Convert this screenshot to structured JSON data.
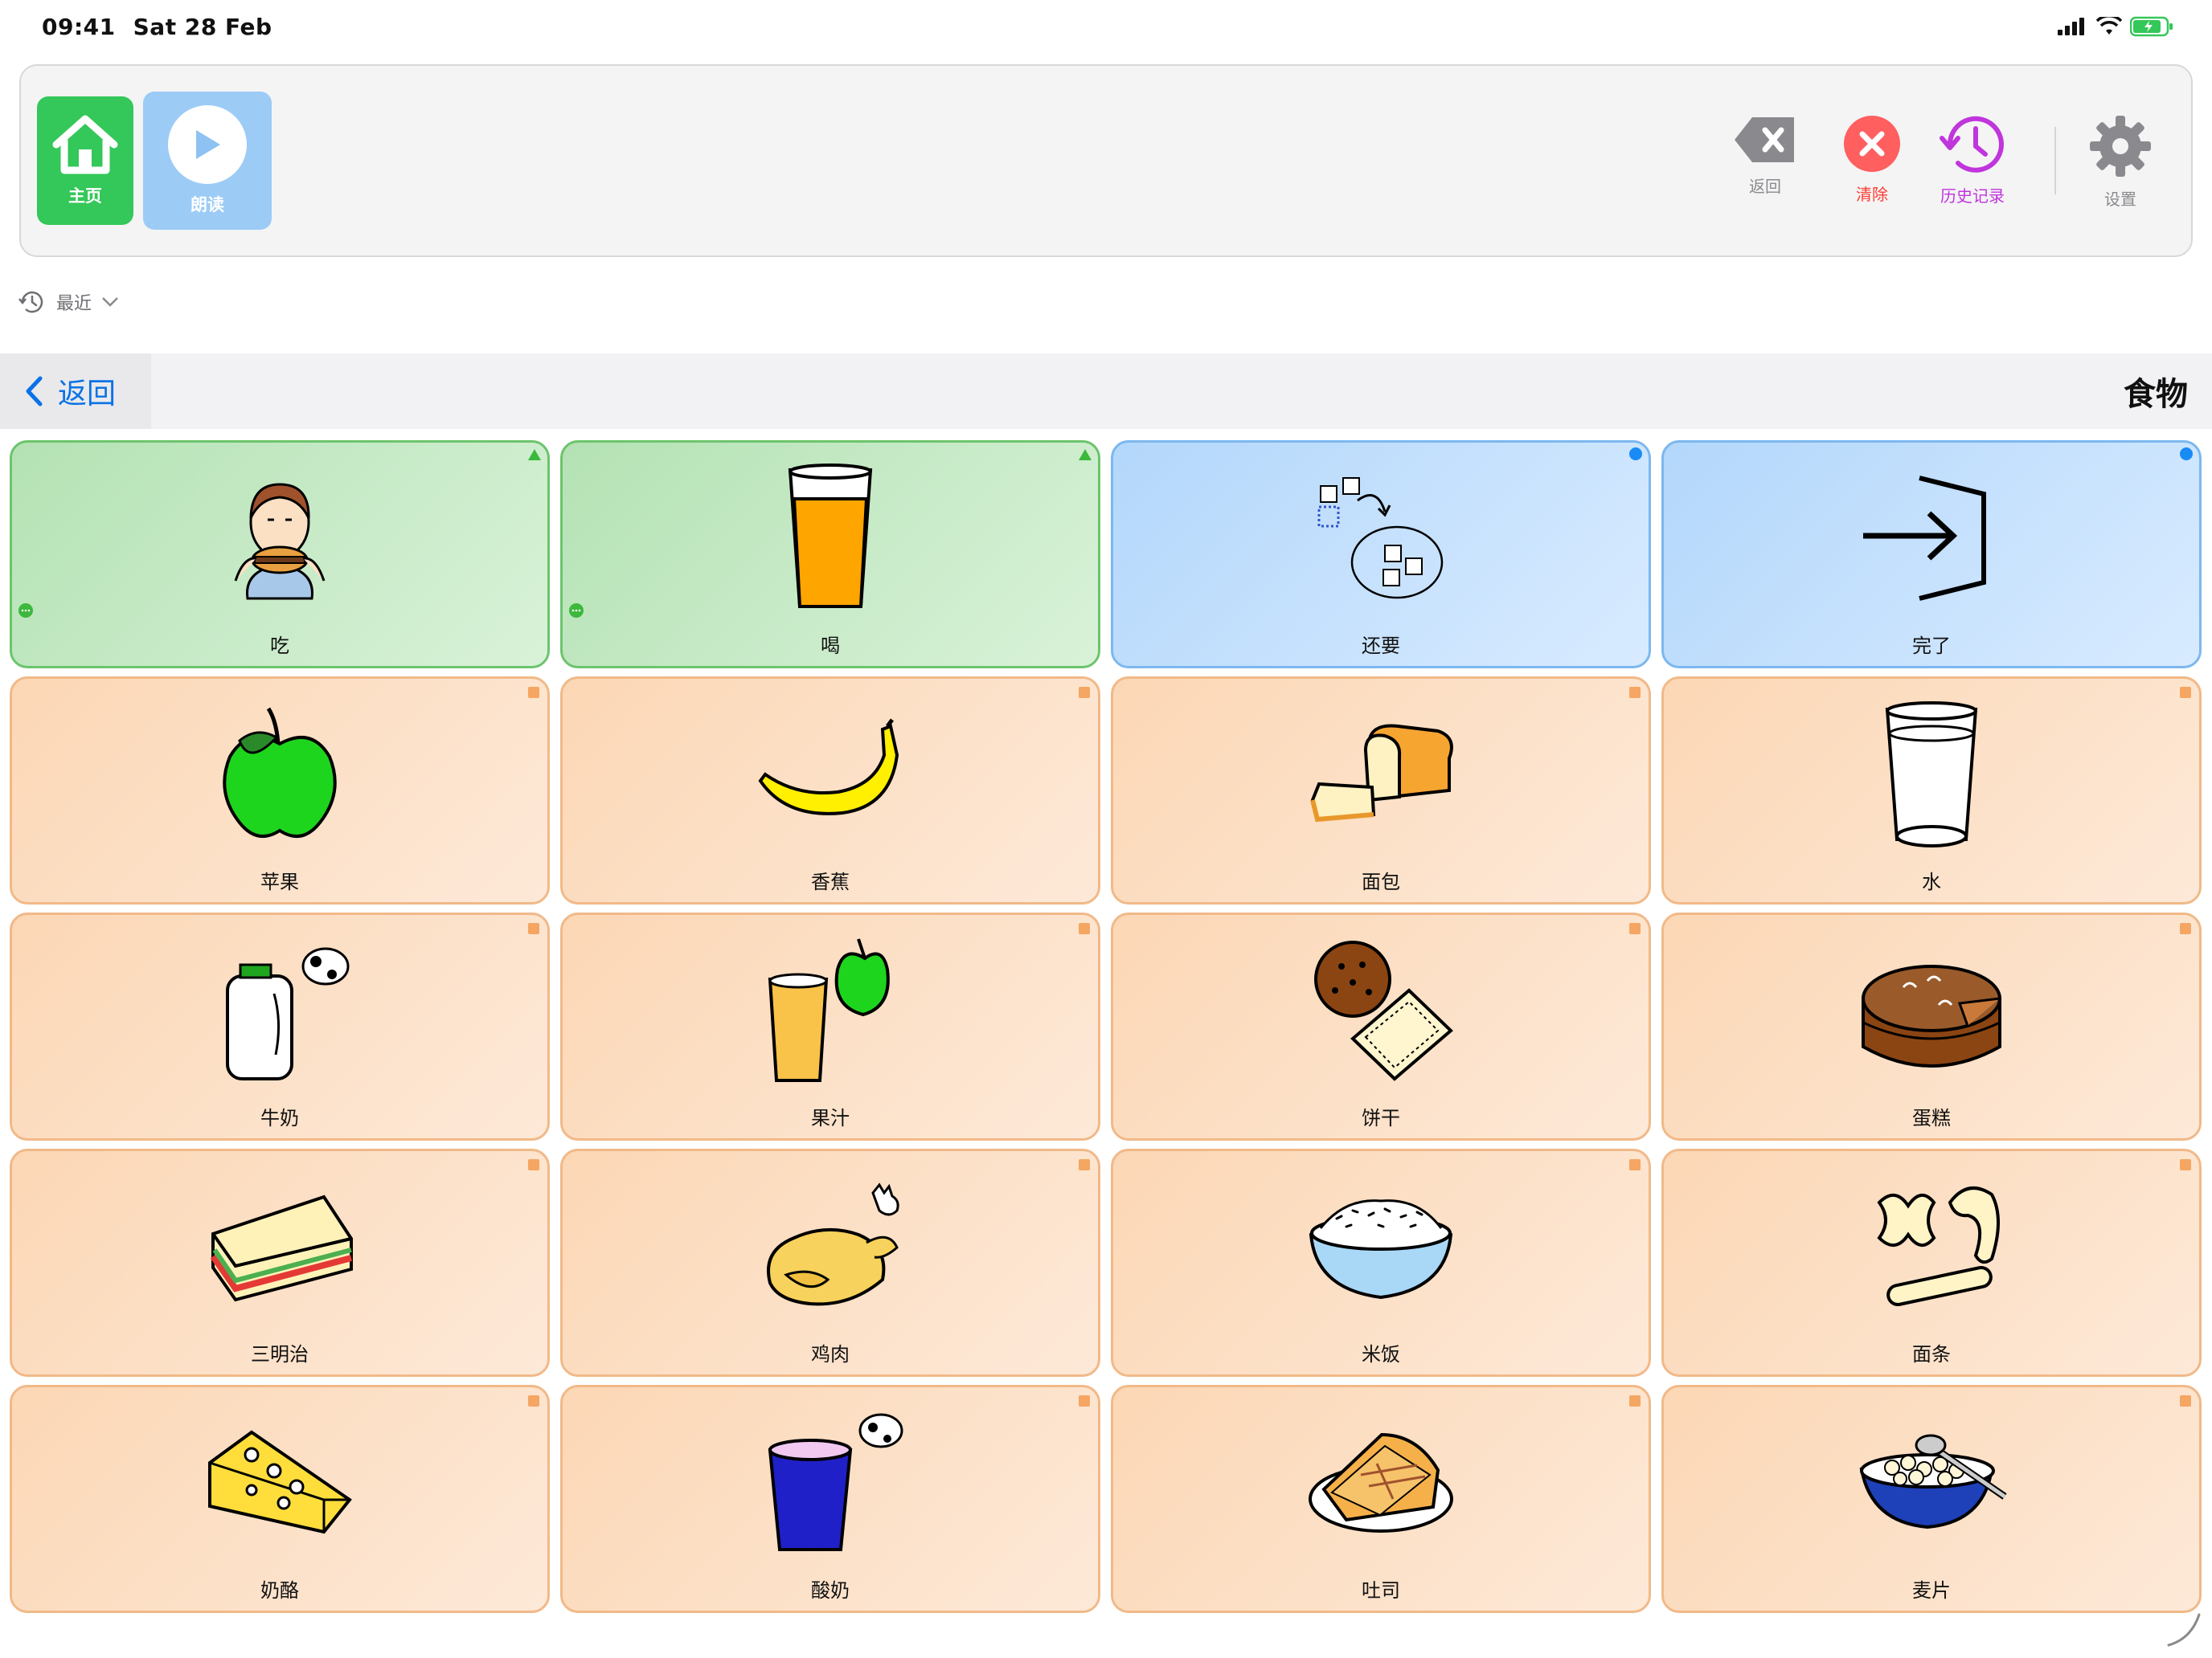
{
  "status_bar": {
    "time": "09:41",
    "date": "Sat 28 Feb"
  },
  "message_bar": {
    "home_label": "主页",
    "speak_label": "朗读",
    "back_label": "返回",
    "clear_label": "清除",
    "history_label": "历史记录",
    "settings_label": "设置"
  },
  "recent": {
    "label": "最近"
  },
  "nav": {
    "back_label": "返回",
    "title": "食物"
  },
  "colors": {
    "verb": "#b4e2b4",
    "social": "#b3d7fb",
    "noun": "#fcd7b5",
    "accent": "#0a72e6"
  },
  "cells": [
    {
      "label": "吃",
      "type": "verb",
      "icon": "eat-icon"
    },
    {
      "label": "喝",
      "type": "verb",
      "icon": "drink-icon"
    },
    {
      "label": "还要",
      "type": "social",
      "icon": "more-icon"
    },
    {
      "label": "完了",
      "type": "social",
      "icon": "finished-icon"
    },
    {
      "label": "苹果",
      "type": "noun",
      "icon": "apple-icon"
    },
    {
      "label": "香蕉",
      "type": "noun",
      "icon": "banana-icon"
    },
    {
      "label": "面包",
      "type": "noun",
      "icon": "bread-icon"
    },
    {
      "label": "水",
      "type": "noun",
      "icon": "water-icon"
    },
    {
      "label": "牛奶",
      "type": "noun",
      "icon": "milk-icon"
    },
    {
      "label": "果汁",
      "type": "noun",
      "icon": "juice-icon"
    },
    {
      "label": "饼干",
      "type": "noun",
      "icon": "biscuit-icon"
    },
    {
      "label": "蛋糕",
      "type": "noun",
      "icon": "cake-icon"
    },
    {
      "label": "三明治",
      "type": "noun",
      "icon": "sandwich-icon"
    },
    {
      "label": "鸡肉",
      "type": "noun",
      "icon": "chicken-icon"
    },
    {
      "label": "米饭",
      "type": "noun",
      "icon": "rice-icon"
    },
    {
      "label": "面条",
      "type": "noun",
      "icon": "pasta-icon"
    },
    {
      "label": "奶酪",
      "type": "noun",
      "icon": "cheese-icon"
    },
    {
      "label": "酸奶",
      "type": "noun",
      "icon": "yogurt-icon"
    },
    {
      "label": "吐司",
      "type": "noun",
      "icon": "toast-icon"
    },
    {
      "label": "麦片",
      "type": "noun",
      "icon": "cereal-icon"
    }
  ]
}
